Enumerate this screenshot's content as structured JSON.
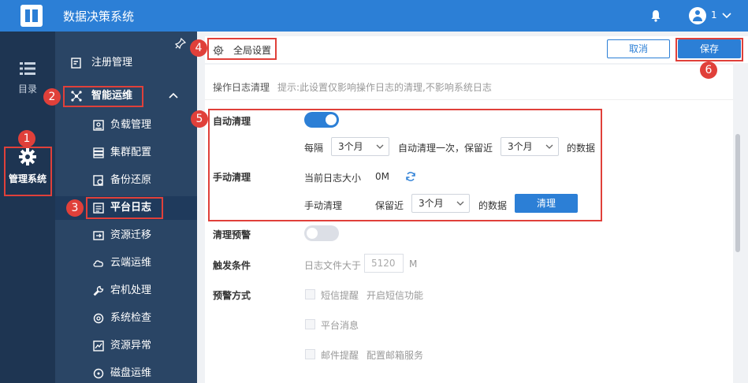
{
  "header": {
    "app_title": "数据决策系统",
    "user_name": "1"
  },
  "rail": {
    "items": [
      {
        "label": "目录",
        "icon": "list-icon"
      },
      {
        "label": "管理系统",
        "icon": "gear-icon"
      }
    ]
  },
  "nav": {
    "items": [
      {
        "label": "注册管理",
        "icon": "register-icon"
      },
      {
        "label": "智能运维",
        "icon": "ops-icon"
      },
      {
        "label": "负载管理",
        "icon": "load-icon"
      },
      {
        "label": "集群配置",
        "icon": "cluster-icon"
      },
      {
        "label": "备份还原",
        "icon": "backup-icon"
      },
      {
        "label": "平台日志",
        "icon": "log-icon"
      },
      {
        "label": "资源迁移",
        "icon": "migrate-icon"
      },
      {
        "label": "云端运维",
        "icon": "cloud-icon"
      },
      {
        "label": "宕机处理",
        "icon": "wrench-icon"
      },
      {
        "label": "系统检查",
        "icon": "check-icon"
      },
      {
        "label": "资源异常",
        "icon": "anomaly-icon"
      },
      {
        "label": "磁盘运维",
        "icon": "disk-icon"
      }
    ],
    "active_index": 5
  },
  "toolbar": {
    "global_settings_label": "全局设置",
    "cancel_label": "取消",
    "save_label": "保存"
  },
  "log_cleanup": {
    "section_title": "操作日志清理",
    "hint": "提示:此设置仅影响操作日志的清理,不影响系统日志",
    "auto_clean": {
      "label": "自动清理",
      "enabled": true,
      "every_label": "每隔",
      "interval": "3个月",
      "middle_text": "自动清理一次，保留近",
      "keep": "3个月",
      "suffix": "的数据"
    },
    "manual_clean": {
      "label": "手动清理",
      "current_size_label": "当前日志大小",
      "current_size": "0M",
      "row_label": "手动清理",
      "keep_label": "保留近",
      "keep": "3个月",
      "suffix": "的数据",
      "button_label": "清理"
    },
    "warning": {
      "label": "清理预警",
      "enabled": false
    },
    "trigger": {
      "label": "触发条件",
      "prefix": "日志文件大于",
      "value": "5120",
      "unit": "M"
    },
    "method": {
      "label": "预警方式",
      "options": [
        {
          "label": "短信提醒",
          "extra": "开启短信功能"
        },
        {
          "label": "平台消息",
          "extra": ""
        },
        {
          "label": "邮件提醒",
          "extra": "配置邮箱服务"
        }
      ]
    }
  },
  "annotations": [
    "1",
    "2",
    "3",
    "4",
    "5",
    "6"
  ],
  "colors": {
    "primary": "#2c7fd6",
    "rail_bg": "#1e3552",
    "nav_bg": "#2a4565",
    "annotation": "#e0403a"
  }
}
